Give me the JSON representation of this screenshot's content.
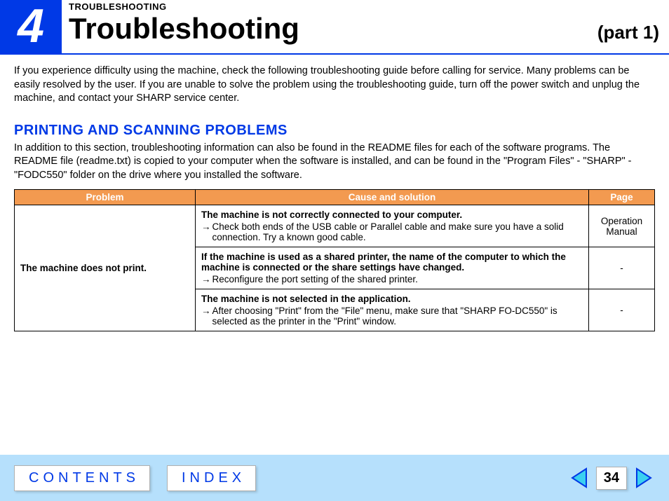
{
  "header": {
    "chapter_number": "4",
    "small_title": "TROUBLESHOOTING",
    "main_title": "Troubleshooting",
    "part_label": "(part 1)"
  },
  "intro": "If you experience difficulty using the machine, check the following troubleshooting guide before calling for service. Many problems can be easily resolved by the user. If you are unable to solve the problem using the troubleshooting guide, turn off the power switch and unplug the machine, and contact your SHARP service center.",
  "section": {
    "title": "PRINTING AND SCANNING PROBLEMS",
    "desc": "In addition to this section, troubleshooting information can also be found in the README files for each of the software programs. The README file (readme.txt) is copied to your computer when the software is installed, and can be found in the \"Program Files\" - \"SHARP\" - \"FODC550\" folder on the drive where you installed the software."
  },
  "table": {
    "headers": {
      "problem": "Problem",
      "cause": "Cause and solution",
      "page": "Page"
    },
    "problem": "The machine does not print.",
    "rows": [
      {
        "cause": "The machine is not correctly connected to your computer.",
        "solution": "Check both ends of the USB cable or Parallel cable and make sure you have a solid connection. Try a known good cable.",
        "page": "Operation Manual"
      },
      {
        "cause": "If the machine is used as a shared printer, the name of the computer to which the machine is connected or the share settings have changed.",
        "solution": "Reconfigure the port setting of the shared printer.",
        "page": "-"
      },
      {
        "cause": "The machine is not selected in the application.",
        "solution": "After choosing \"Print\" from the \"File\" menu, make sure that \"SHARP FO-DC550\" is selected as the printer in the \"Print\" window.",
        "page": "-"
      }
    ]
  },
  "footer": {
    "contents": "CONTENTS",
    "index": "INDEX",
    "page_number": "34"
  }
}
